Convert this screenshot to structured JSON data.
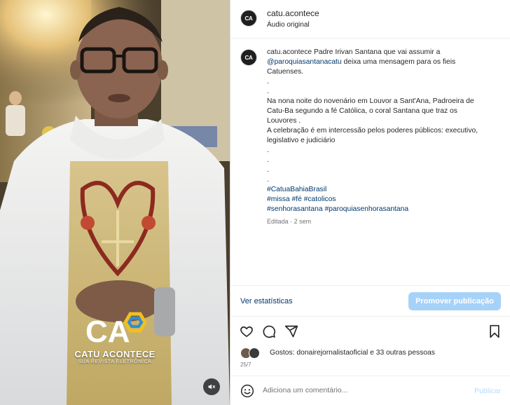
{
  "post": {
    "username": "catu.acontece",
    "audio_label": "Áudio original",
    "avatar_initials": "CA"
  },
  "media": {
    "brand_initials": "CA",
    "brand_name": "CATU ACONTECE",
    "brand_tagline": "SUA REVISTA ELETRÔNICA",
    "mute_icon": "speaker-muted-icon"
  },
  "caption": {
    "username": "catu.acontece",
    "first_text": "Padre Irivan Santana que vai assumir a",
    "mention": "@paroquiasantanacatu",
    "mention_rest": "deixa uma mensagem para os fieis",
    "line3": "Catuenses.",
    "dot1": ".",
    "dot2": ".",
    "line6": "Na nona noite do novenário em Louvor a Sant'Ana, Padroeira de",
    "line7": "Catu-Ba segundo a fé Católica, o coral Santana que traz os",
    "line8": "Louvores .",
    "line9": "A celebração é em intercessão pelos poderes públicos: executivo,",
    "line10": "legislativo e judiciário",
    "dot3": ".",
    "dot4": ".",
    "dot5": ".",
    "dot6": ".",
    "hashtags1": "#CatuaBahiaBrasil",
    "hashtags2": "#missa #fé #catolicos",
    "hashtags3": "#senhorasantana #paroquiasenhorasantana",
    "edited": "Editada",
    "edited_sep": "·",
    "edited_time": "2 sem"
  },
  "stats": {
    "see_stats_label": "Ver estatísticas",
    "promote_label": "Promover publicação"
  },
  "likes": {
    "prefix": "Gostos:",
    "user": "donairejornalistaoficial",
    "rest": "e 33 outras pessoas"
  },
  "date": "25/7",
  "comment": {
    "placeholder": "Adiciona um comentário...",
    "publish_label": "Publicar"
  },
  "colors": {
    "link": "#00376b",
    "promote_bg": "#a6d2f9",
    "publish_disabled": "#b3dbff",
    "muted_text": "#737373"
  },
  "icons": [
    "heart-icon",
    "comment-icon",
    "share-icon",
    "save-icon",
    "emoji-icon",
    "speaker-muted-icon"
  ]
}
